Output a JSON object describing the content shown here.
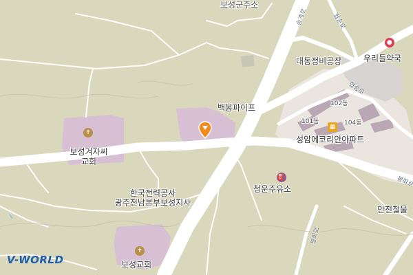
{
  "map": {
    "logo": "V-WORLD",
    "colors": {
      "land": "#d9d8bd",
      "road": "#ffffff",
      "building": "#d7c0d4",
      "apartment_zone": "#eae6df",
      "pin": "#f28a1c",
      "logo_blue": "#1f5fae"
    },
    "places": {
      "pipe_company": "백봉파이프",
      "daedong_repair": "대동정비공장",
      "uri_pharmacy": "우리들약국",
      "apartment": "성암에코리안아파트",
      "apt_101": "101동",
      "apt_102": "102동",
      "apt_104": "104동",
      "cheongun_gas": "청운주유소",
      "safety_rail": "안전철물",
      "kepco": "한국전력공사\n광주전남본부보성지사",
      "boseong_witness_church": "보성겨자씨\n교회",
      "boseong_church": "보성교회",
      "top_partial": "보성군주소"
    },
    "roads": {
      "seunggye": "송계로",
      "hyeopsong": "협송로",
      "hyeopsong_2": "협송로",
      "bonghwa": "봉화로",
      "bonghwa_2": "봉화로"
    },
    "icons": [
      "church-icon",
      "gas-station-icon",
      "apartment-icon",
      "pharmacy-icon",
      "location-pin-icon"
    ]
  }
}
